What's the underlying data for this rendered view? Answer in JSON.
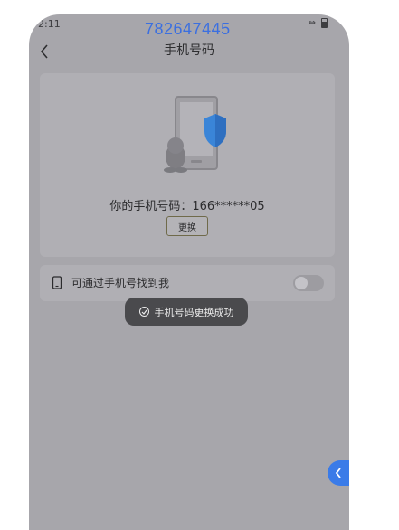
{
  "status": {
    "time": "2:11"
  },
  "overlay": {
    "number": "782647445"
  },
  "header": {
    "title": "手机号码"
  },
  "main": {
    "phone_line": "你的手机号码：166******05",
    "change_button": "更换"
  },
  "setting": {
    "label": "可通过手机号找到我",
    "toggle_on": false
  },
  "toast": {
    "message": "手机号码更换成功"
  },
  "icons": {
    "back": "chevron-left-icon",
    "phone": "smartphone-icon",
    "check": "check-circle-icon",
    "float": "chevron-left-icon"
  },
  "colors": {
    "overlay_text": "#3b6fe0",
    "shield": "#3a85d8",
    "float_button": "#3a7be8"
  }
}
